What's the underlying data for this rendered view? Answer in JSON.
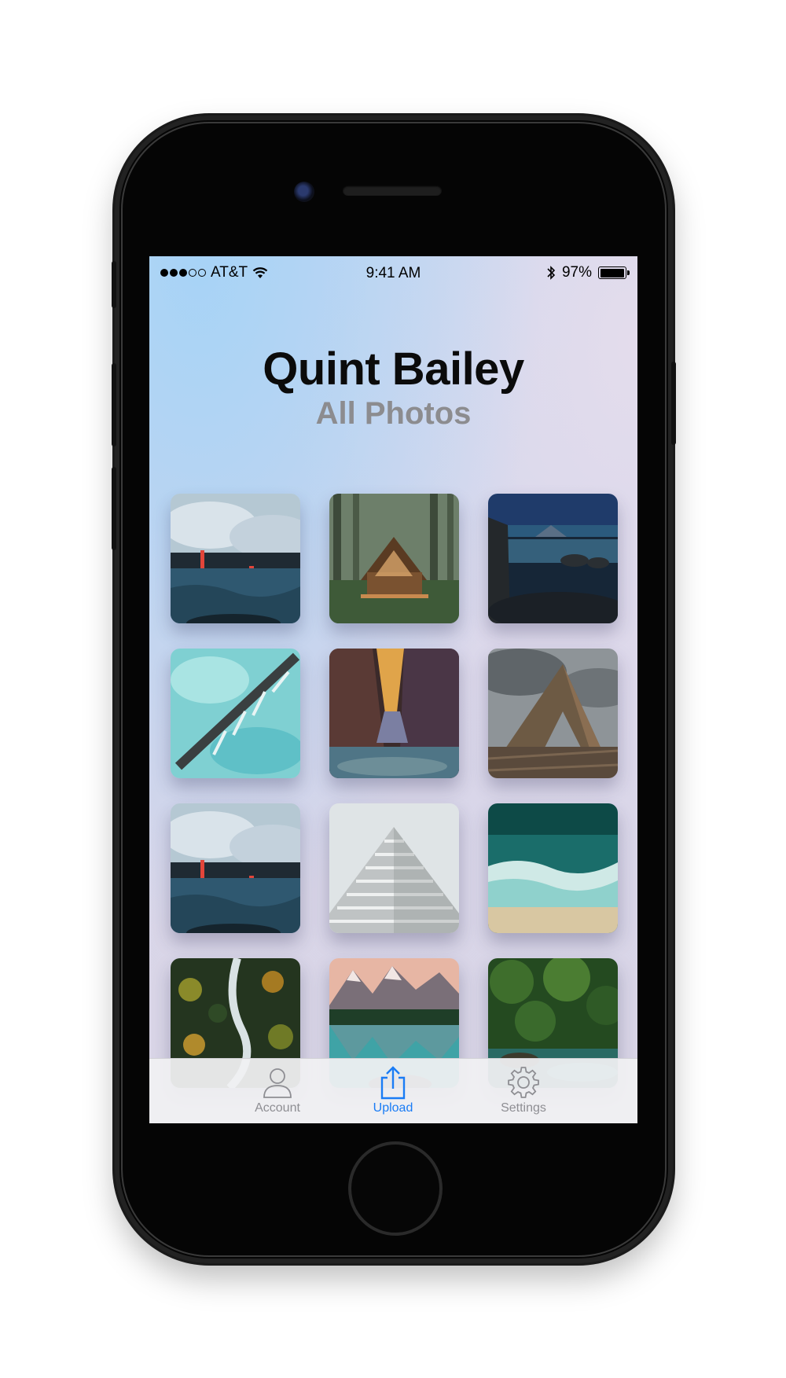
{
  "status_bar": {
    "carrier": "AT&T",
    "time": "9:41 AM",
    "battery": "97%",
    "battery_level": 0.97,
    "signal_bars": 3,
    "signal_total": 5
  },
  "header": {
    "title": "Quint Bailey",
    "subtitle": "All Photos"
  },
  "photos": [
    {
      "name": "lava-ocean-photo"
    },
    {
      "name": "forest-cabin-photo"
    },
    {
      "name": "night-lake-photo"
    },
    {
      "name": "aerial-glacier-photo"
    },
    {
      "name": "canyon-river-photo"
    },
    {
      "name": "rock-arch-photo"
    },
    {
      "name": "lava-ocean-photo-2"
    },
    {
      "name": "building-tiers-photo"
    },
    {
      "name": "aerial-waves-photo"
    },
    {
      "name": "forest-river-aerial-photo"
    },
    {
      "name": "mountain-lake-photo"
    },
    {
      "name": "jungle-pool-photo"
    }
  ],
  "tab_bar": {
    "active_color": "#1a7cf5",
    "inactive_color": "#8e8e93",
    "tabs": [
      {
        "label": "Account",
        "icon": "person-icon"
      },
      {
        "label": "Upload",
        "icon": "share-upload-icon"
      },
      {
        "label": "Settings",
        "icon": "gear-icon"
      }
    ]
  }
}
